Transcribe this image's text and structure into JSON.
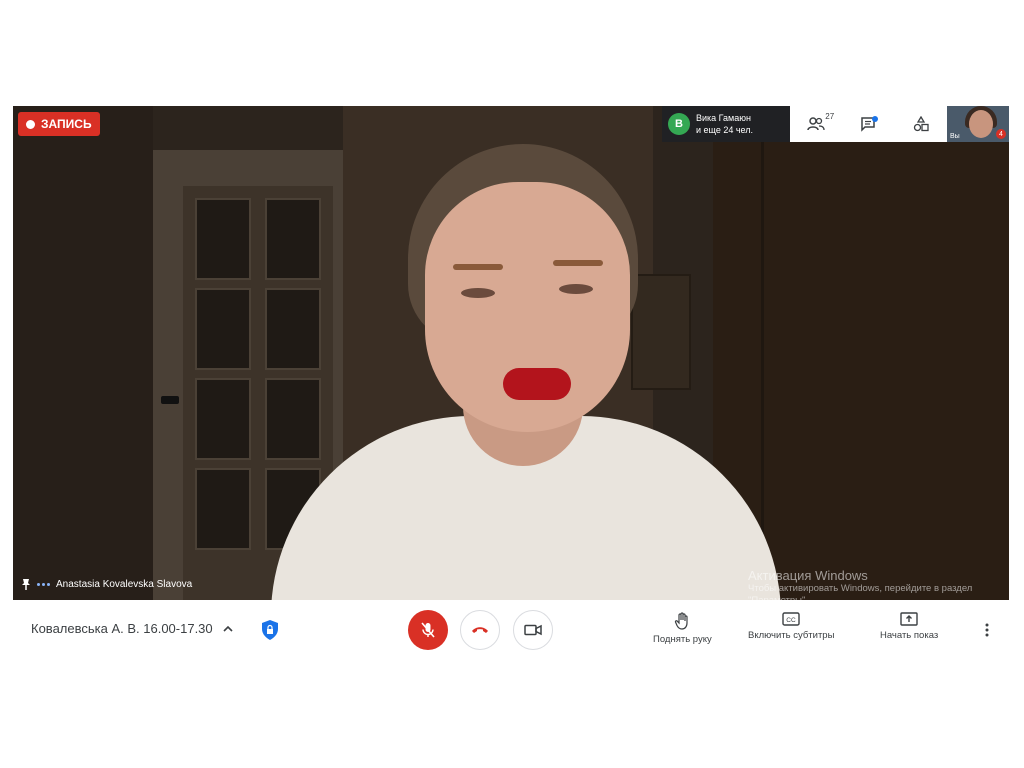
{
  "recording": {
    "label": "ЗАПИСЬ"
  },
  "presentation_chip": {
    "avatar_letter": "В",
    "line1": "Вика Гамаюн",
    "line2": "и еще 24 чел."
  },
  "top_toolbar": {
    "people_count": "27",
    "icons": [
      "people-icon",
      "chat-icon",
      "activities-icon"
    ]
  },
  "self_view": {
    "label": "Вы",
    "badge": "4"
  },
  "speaker": {
    "name": "Anastasia Kovalevska Slavova"
  },
  "windows_watermark": {
    "title": "Активация Windows",
    "subtitle": "Чтобы активировать Windows, перейдите в раздел \"Параметры\"."
  },
  "bottom_bar": {
    "meeting_title": "Ковалевська А. В. 16.00-17.30",
    "raise_hand": "Поднять руку",
    "captions": "Включить субтитры",
    "present": "Начать показ"
  },
  "colors": {
    "record_red": "#d93025",
    "mic_off_red": "#d93025",
    "accent_blue": "#1a73e8",
    "avatar_green": "#34a853"
  }
}
